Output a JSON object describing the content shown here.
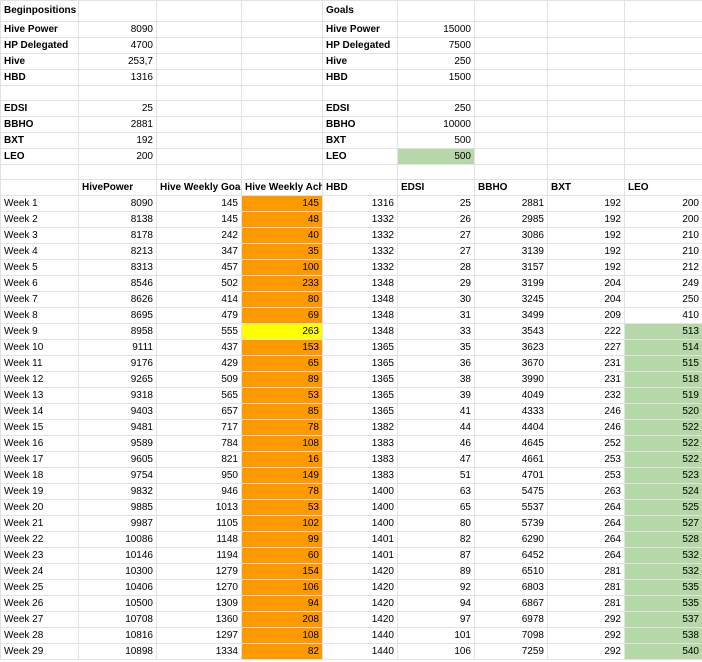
{
  "colors": {
    "orange": "#ff9900",
    "yellow": "#ffff00",
    "green": "#b6d7a8"
  },
  "begin": {
    "title": "Beginpositions",
    "rows": [
      {
        "label": "Hive Power",
        "value": "8090"
      },
      {
        "label": "HP Delegated",
        "value": "4700"
      },
      {
        "label": "Hive",
        "value": "253,7"
      },
      {
        "label": "HBD",
        "value": "1316"
      },
      {
        "label": "",
        "value": ""
      },
      {
        "label": "EDSI",
        "value": "25"
      },
      {
        "label": "BBHO",
        "value": "2881"
      },
      {
        "label": "BXT",
        "value": "192"
      },
      {
        "label": "LEO",
        "value": "200"
      }
    ]
  },
  "goals": {
    "title": "Goals",
    "rows": [
      {
        "label": "Hive Power",
        "value": "15000"
      },
      {
        "label": "HP Delegated",
        "value": "7500"
      },
      {
        "label": "Hive",
        "value": "250"
      },
      {
        "label": "HBD",
        "value": "1500"
      },
      {
        "label": "",
        "value": ""
      },
      {
        "label": "EDSI",
        "value": "250"
      },
      {
        "label": "BBHO",
        "value": "10000"
      },
      {
        "label": "BXT",
        "value": "500"
      },
      {
        "label": "LEO",
        "value": "500"
      }
    ]
  },
  "weekly": {
    "headers": [
      "",
      "HivePower",
      "Hive Weekly Goal",
      "Hive Weekly Ach",
      "HBD",
      "EDSI",
      "BBHO",
      "BXT",
      "LEO"
    ],
    "rows": [
      [
        "Week 1",
        "8090",
        "145",
        "145",
        "1316",
        "25",
        "2881",
        "192",
        "200"
      ],
      [
        "Week 2",
        "8138",
        "145",
        "48",
        "1332",
        "26",
        "2985",
        "192",
        "200"
      ],
      [
        "Week 3",
        "8178",
        "242",
        "40",
        "1332",
        "27",
        "3086",
        "192",
        "210"
      ],
      [
        "Week 4",
        "8213",
        "347",
        "35",
        "1332",
        "27",
        "3139",
        "192",
        "210"
      ],
      [
        "Week 5",
        "8313",
        "457",
        "100",
        "1332",
        "28",
        "3157",
        "192",
        "212"
      ],
      [
        "Week 6",
        "8546",
        "502",
        "233",
        "1348",
        "29",
        "3199",
        "204",
        "249"
      ],
      [
        "Week 7",
        "8626",
        "414",
        "80",
        "1348",
        "30",
        "3245",
        "204",
        "250"
      ],
      [
        "Week 8",
        "8695",
        "479",
        "69",
        "1348",
        "31",
        "3499",
        "209",
        "410"
      ],
      [
        "Week 9",
        "8958",
        "555",
        "263",
        "1348",
        "33",
        "3543",
        "222",
        "513"
      ],
      [
        "Week 10",
        "9111",
        "437",
        "153",
        "1365",
        "35",
        "3623",
        "227",
        "514"
      ],
      [
        "Week 11",
        "9176",
        "429",
        "65",
        "1365",
        "36",
        "3670",
        "231",
        "515"
      ],
      [
        "Week 12",
        "9265",
        "509",
        "89",
        "1365",
        "38",
        "3990",
        "231",
        "518"
      ],
      [
        "Week 13",
        "9318",
        "565",
        "53",
        "1365",
        "39",
        "4049",
        "232",
        "519"
      ],
      [
        "Week 14",
        "9403",
        "657",
        "85",
        "1365",
        "41",
        "4333",
        "246",
        "520"
      ],
      [
        "Week 15",
        "9481",
        "717",
        "78",
        "1382",
        "44",
        "4404",
        "246",
        "522"
      ],
      [
        "Week 16",
        "9589",
        "784",
        "108",
        "1383",
        "46",
        "4645",
        "252",
        "522"
      ],
      [
        "Week 17",
        "9605",
        "821",
        "16",
        "1383",
        "47",
        "4661",
        "253",
        "522"
      ],
      [
        "Week 18",
        "9754",
        "950",
        "149",
        "1383",
        "51",
        "4701",
        "253",
        "523"
      ],
      [
        "Week 19",
        "9832",
        "946",
        "78",
        "1400",
        "63",
        "5475",
        "263",
        "524"
      ],
      [
        "Week 20",
        "9885",
        "1013",
        "53",
        "1400",
        "65",
        "5537",
        "264",
        "525"
      ],
      [
        "Week 21",
        "9987",
        "1105",
        "102",
        "1400",
        "80",
        "5739",
        "264",
        "527"
      ],
      [
        "Week 22",
        "10086",
        "1148",
        "99",
        "1401",
        "82",
        "6290",
        "264",
        "528"
      ],
      [
        "Week 23",
        "10146",
        "1194",
        "60",
        "1401",
        "87",
        "6452",
        "264",
        "532"
      ],
      [
        "Week 24",
        "10300",
        "1279",
        "154",
        "1420",
        "89",
        "6510",
        "281",
        "532"
      ],
      [
        "Week 25",
        "10406",
        "1270",
        "106",
        "1420",
        "92",
        "6803",
        "281",
        "535"
      ],
      [
        "Week 26",
        "10500",
        "1309",
        "94",
        "1420",
        "94",
        "6867",
        "281",
        "535"
      ],
      [
        "Week 27",
        "10708",
        "1360",
        "208",
        "1420",
        "97",
        "6978",
        "292",
        "537"
      ],
      [
        "Week 28",
        "10816",
        "1297",
        "108",
        "1440",
        "101",
        "7098",
        "292",
        "538"
      ],
      [
        "Week 29",
        "10898",
        "1334",
        "82",
        "1440",
        "106",
        "7259",
        "292",
        "540"
      ]
    ]
  }
}
